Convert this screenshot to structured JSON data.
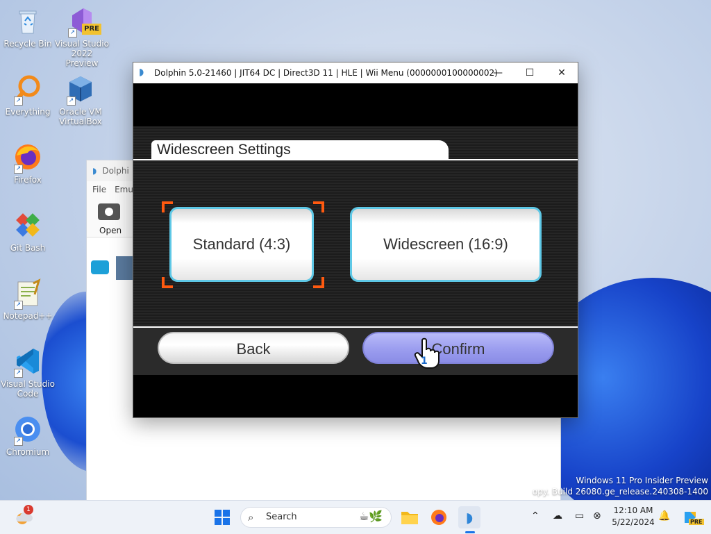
{
  "desktop": {
    "icons": [
      {
        "label": "Recycle Bin",
        "icon": "recycle-bin-icon"
      },
      {
        "label": "Visual Studio 2022 Preview",
        "icon": "visual-studio-preview-icon",
        "badge": "PRE"
      },
      {
        "label": "Everything",
        "icon": "everything-search-icon"
      },
      {
        "label": "Oracle VM VirtualBox",
        "icon": "virtualbox-icon"
      },
      {
        "label": "Firefox",
        "icon": "firefox-icon"
      },
      {
        "label": "Git Bash",
        "icon": "git-bash-icon"
      },
      {
        "label": "Notepad++",
        "icon": "notepad-plus-plus-icon"
      },
      {
        "label": "Visual Studio Code",
        "icon": "vscode-icon"
      },
      {
        "label": "Chromium",
        "icon": "chromium-icon"
      }
    ],
    "watermark": {
      "line1": "Windows 11 Pro Insider Preview",
      "line2": "opy. Build 26080.ge_release.240308-1400"
    }
  },
  "background_window": {
    "title": "Dolphi",
    "menu": [
      "File",
      "Emu"
    ],
    "toolbar_open": "Open"
  },
  "dolphin_window": {
    "title": "Dolphin 5.0-21460 | JIT64 DC | Direct3D 11 | HLE | Wii Menu (0000000100000002)",
    "minimize": "—",
    "maximize": "☐",
    "close": "✕"
  },
  "wii_screen": {
    "header": "Widescreen Settings",
    "option_standard": "Standard (4:3)",
    "option_widescreen": "Widescreen (16:9)",
    "selected_option": "Standard (4:3)",
    "back": "Back",
    "confirm": "Confirm",
    "pointer_player": "1"
  },
  "taskbar": {
    "search_placeholder": "Search",
    "notification_count": "1",
    "time": "12:10 AM",
    "date": "5/22/2024",
    "copilot_badge": "PRE",
    "colors": {
      "accent": "#1a73e8",
      "wii_cyan": "#5ec8e6",
      "wii_selection": "#ff5a10",
      "confirm_purple": "#9d9ff0"
    }
  }
}
